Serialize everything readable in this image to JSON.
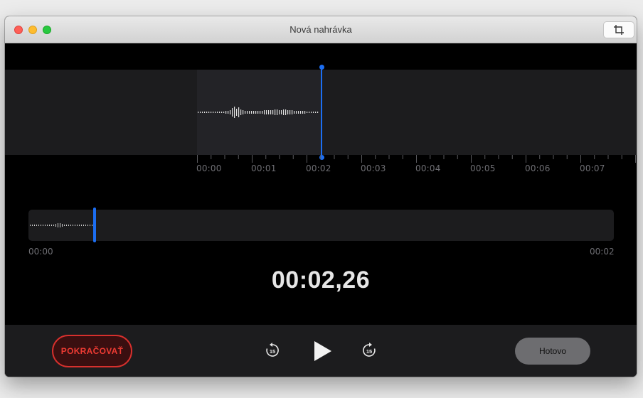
{
  "window": {
    "title": "Nová nahrávka",
    "crop_icon": "crop-icon"
  },
  "timeline": {
    "ticks": [
      "00:00",
      "00:01",
      "00:02",
      "00:03",
      "00:04",
      "00:05",
      "00:06",
      "00:07"
    ],
    "playhead_fraction_of_recording": 1.0
  },
  "scrubber": {
    "start_label": "00:00",
    "end_label": "00:02"
  },
  "time_display": "00:02,26",
  "controls": {
    "resume_label": "POKRAČOVAŤ",
    "skip_back_label": "15",
    "skip_forward_label": "15",
    "play_icon": "play-icon",
    "done_label": "Hotovo"
  },
  "colors": {
    "accent": "#1c6ef2",
    "resume": "#ee3b33",
    "background": "#000000"
  }
}
